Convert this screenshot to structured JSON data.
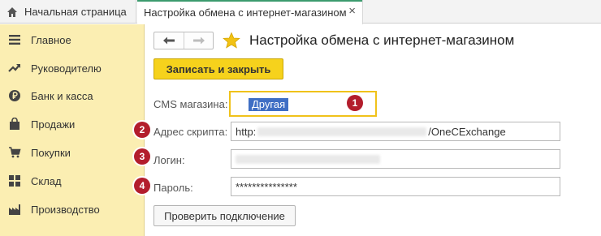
{
  "tabs": {
    "home_label": "Начальная страница",
    "active_label": "Настройка обмена с интернет-магазином",
    "close_glyph": "×"
  },
  "sidebar": {
    "items": [
      {
        "label": "Главное",
        "icon": "menu-icon"
      },
      {
        "label": "Руководителю",
        "icon": "trend-icon"
      },
      {
        "label": "Банк и касса",
        "icon": "ruble-coin-icon"
      },
      {
        "label": "Продажи",
        "icon": "bag-icon"
      },
      {
        "label": "Покупки",
        "icon": "cart-icon"
      },
      {
        "label": "Склад",
        "icon": "grid-icon"
      },
      {
        "label": "Производство",
        "icon": "factory-icon"
      }
    ]
  },
  "header": {
    "title": "Настройка обмена с интернет-магазином"
  },
  "toolbar": {
    "save_close_label": "Записать и закрыть",
    "check_connection_label": "Проверить подключение"
  },
  "form": {
    "cms_label": "CMS магазина:",
    "cms_value": "Другая",
    "script_label": "Адрес скрипта:",
    "script_value_prefix": "http:",
    "script_value_suffix": "/OneCExchange",
    "login_label": "Логин:",
    "password_label": "Пароль:",
    "password_value": "***************"
  },
  "badges": [
    "1",
    "2",
    "3",
    "4"
  ],
  "colors": {
    "sidebar_bg": "#fbeeb2",
    "primary_button": "#f6d21c",
    "badge": "#b31d2c",
    "selection": "#3f6ec4",
    "active_tab_accent": "#3c9b6e"
  }
}
